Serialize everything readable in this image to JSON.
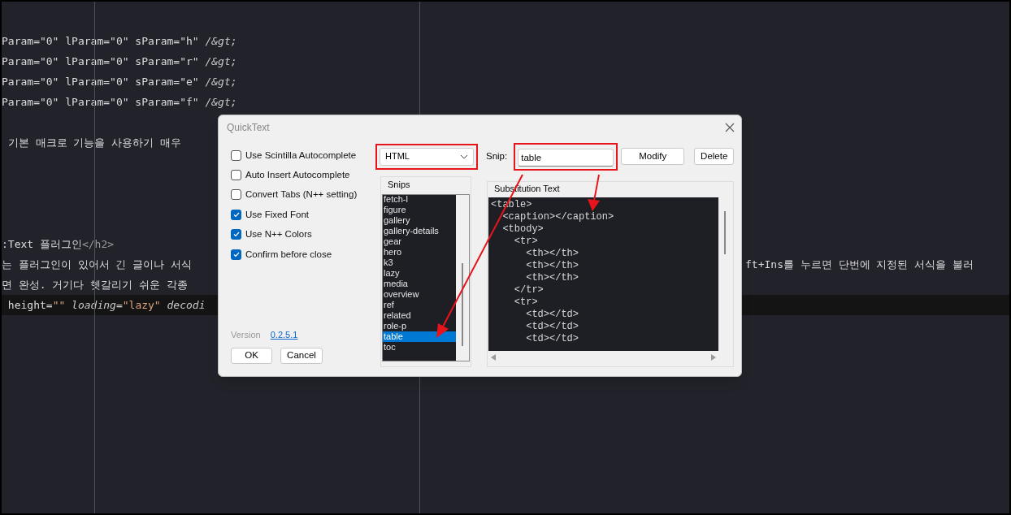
{
  "editor": {
    "lines": [
      {
        "kind": "code",
        "current": false,
        "segments": [
          {
            "tokens": [
              {
                "kind": "plain",
                "text": "Param=\"0\" lParam=\"0\" sParam=\"h\" "
              },
              {
                "kind": "italic",
                "text": "/&gt;"
              }
            ]
          }
        ]
      },
      {
        "kind": "code",
        "current": false,
        "segments": [
          {
            "tokens": [
              {
                "kind": "plain",
                "text": "Param=\"0\" lParam=\"0\" sParam=\"r\" "
              },
              {
                "kind": "italic",
                "text": "/&gt;"
              }
            ]
          }
        ]
      },
      {
        "kind": "code",
        "current": false,
        "segments": [
          {
            "tokens": [
              {
                "kind": "plain",
                "text": "Param=\"0\" lParam=\"0\" sParam=\"e\" "
              },
              {
                "kind": "italic",
                "text": "/&gt;"
              }
            ]
          }
        ]
      },
      {
        "kind": "code",
        "current": false,
        "segments": [
          {
            "tokens": [
              {
                "kind": "plain",
                "text": "Param=\"0\" lParam=\"0\" sParam=\"f\" "
              },
              {
                "kind": "italic",
                "text": "/&gt;"
              }
            ]
          }
        ]
      },
      {
        "kind": "blank"
      },
      {
        "kind": "code",
        "current": false,
        "segments": [
          {
            "tokens": [
              {
                "kind": "plain",
                "text": " 기본 매크로 기능을 사용하기 매우"
              }
            ]
          }
        ]
      },
      {
        "kind": "blank"
      },
      {
        "kind": "blank"
      },
      {
        "kind": "blank"
      },
      {
        "kind": "blank"
      },
      {
        "kind": "code",
        "current": false,
        "segments": [
          {
            "tokens": [
              {
                "kind": "plain",
                "text": ":Text 플러그인"
              },
              {
                "kind": "tag",
                "text": "</h2>"
              }
            ]
          }
        ]
      },
      {
        "kind": "code",
        "current": false,
        "segments": [
          {
            "tokens": [
              {
                "kind": "plain",
                "text": "는 플러그인이 있어서 긴 글이나 서식"
              }
            ]
          },
          {
            "tokens": [
              {
                "kind": "plain",
                "text": "ft+Ins를 누르면 단번에 지정된 서식을 불러"
              }
            ]
          }
        ]
      },
      {
        "kind": "code",
        "current": false,
        "segments": [
          {
            "tokens": [
              {
                "kind": "plain",
                "text": "면 완성. 거기다 헷갈리기 쉬운 각종"
              }
            ]
          }
        ]
      },
      {
        "kind": "code",
        "current": true,
        "segments": [
          {
            "tokens": [
              {
                "kind": "plain",
                "text": " height="
              },
              {
                "kind": "string",
                "text": "\"\""
              },
              {
                "kind": "italic",
                "text": " loading"
              },
              {
                "kind": "plain",
                "text": "="
              },
              {
                "kind": "string",
                "text": "\"lazy\""
              },
              {
                "kind": "italic",
                "text": " decodi"
              }
            ]
          }
        ]
      }
    ]
  },
  "dialog": {
    "title": "QuickText",
    "options": [
      {
        "label": "Use Scintilla Autocomplete",
        "checked": false
      },
      {
        "label": "Auto Insert Autocomplete",
        "checked": false
      },
      {
        "label": "Convert Tabs (N++ setting)",
        "checked": false
      },
      {
        "label": "Use Fixed Font",
        "checked": true
      },
      {
        "label": "Use N++ Colors",
        "checked": true
      },
      {
        "label": "Confirm before close",
        "checked": true
      }
    ],
    "version_label": "Version",
    "version": "0.2.5.1",
    "buttons": [
      "OK",
      "Cancel"
    ],
    "language": {
      "value": "HTML"
    },
    "snip": {
      "label": "Snip:",
      "value": "table"
    },
    "actions": [
      "Modify",
      "Delete"
    ],
    "snips": {
      "title": "Snips",
      "items": [
        {
          "label": "fetch-l",
          "selected": false
        },
        {
          "label": "figure",
          "selected": false
        },
        {
          "label": "gallery",
          "selected": false
        },
        {
          "label": "gallery-details",
          "selected": false
        },
        {
          "label": "gear",
          "selected": false
        },
        {
          "label": "hero",
          "selected": false
        },
        {
          "label": "k3",
          "selected": false
        },
        {
          "label": "lazy",
          "selected": false
        },
        {
          "label": "media",
          "selected": false
        },
        {
          "label": "overview",
          "selected": false
        },
        {
          "label": "ref",
          "selected": false
        },
        {
          "label": "related",
          "selected": false
        },
        {
          "label": "role-p",
          "selected": false
        },
        {
          "label": "table",
          "selected": true
        },
        {
          "label": "toc",
          "selected": false
        }
      ]
    },
    "substitution": {
      "title": "Substitution Text",
      "lines": [
        "<table>",
        "  <caption></caption>",
        "  <tbody>",
        "    <tr>",
        "      <th></th>",
        "      <th></th>",
        "      <th></th>",
        "    </tr>",
        "    <tr>",
        "      <td></td>",
        "      <td></td>",
        "      <td></td>"
      ]
    }
  }
}
